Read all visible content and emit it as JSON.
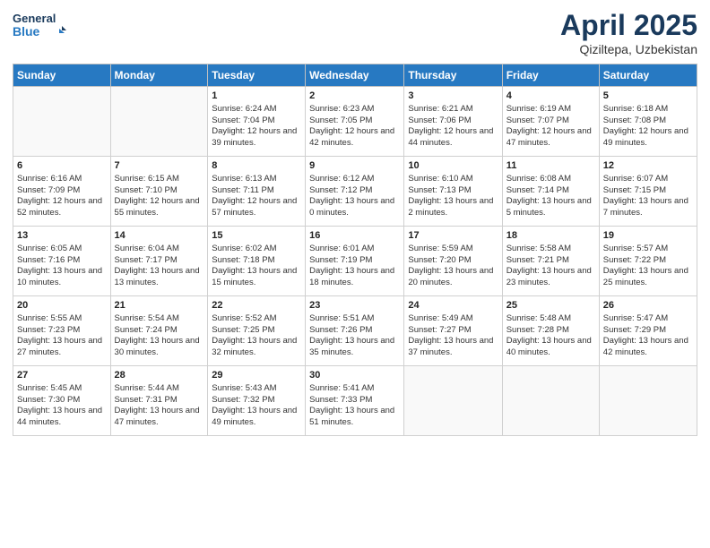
{
  "header": {
    "logo_line1": "General",
    "logo_line2": "Blue",
    "title": "April 2025",
    "subtitle": "Qiziltepa, Uzbekistan"
  },
  "days_of_week": [
    "Sunday",
    "Monday",
    "Tuesday",
    "Wednesday",
    "Thursday",
    "Friday",
    "Saturday"
  ],
  "weeks": [
    [
      {
        "day": "",
        "empty": true
      },
      {
        "day": "",
        "empty": true
      },
      {
        "day": "1",
        "sunrise": "6:24 AM",
        "sunset": "7:04 PM",
        "daylight": "12 hours and 39 minutes."
      },
      {
        "day": "2",
        "sunrise": "6:23 AM",
        "sunset": "7:05 PM",
        "daylight": "12 hours and 42 minutes."
      },
      {
        "day": "3",
        "sunrise": "6:21 AM",
        "sunset": "7:06 PM",
        "daylight": "12 hours and 44 minutes."
      },
      {
        "day": "4",
        "sunrise": "6:19 AM",
        "sunset": "7:07 PM",
        "daylight": "12 hours and 47 minutes."
      },
      {
        "day": "5",
        "sunrise": "6:18 AM",
        "sunset": "7:08 PM",
        "daylight": "12 hours and 49 minutes."
      }
    ],
    [
      {
        "day": "6",
        "sunrise": "6:16 AM",
        "sunset": "7:09 PM",
        "daylight": "12 hours and 52 minutes."
      },
      {
        "day": "7",
        "sunrise": "6:15 AM",
        "sunset": "7:10 PM",
        "daylight": "12 hours and 55 minutes."
      },
      {
        "day": "8",
        "sunrise": "6:13 AM",
        "sunset": "7:11 PM",
        "daylight": "12 hours and 57 minutes."
      },
      {
        "day": "9",
        "sunrise": "6:12 AM",
        "sunset": "7:12 PM",
        "daylight": "13 hours and 0 minutes."
      },
      {
        "day": "10",
        "sunrise": "6:10 AM",
        "sunset": "7:13 PM",
        "daylight": "13 hours and 2 minutes."
      },
      {
        "day": "11",
        "sunrise": "6:08 AM",
        "sunset": "7:14 PM",
        "daylight": "13 hours and 5 minutes."
      },
      {
        "day": "12",
        "sunrise": "6:07 AM",
        "sunset": "7:15 PM",
        "daylight": "13 hours and 7 minutes."
      }
    ],
    [
      {
        "day": "13",
        "sunrise": "6:05 AM",
        "sunset": "7:16 PM",
        "daylight": "13 hours and 10 minutes."
      },
      {
        "day": "14",
        "sunrise": "6:04 AM",
        "sunset": "7:17 PM",
        "daylight": "13 hours and 13 minutes."
      },
      {
        "day": "15",
        "sunrise": "6:02 AM",
        "sunset": "7:18 PM",
        "daylight": "13 hours and 15 minutes."
      },
      {
        "day": "16",
        "sunrise": "6:01 AM",
        "sunset": "7:19 PM",
        "daylight": "13 hours and 18 minutes."
      },
      {
        "day": "17",
        "sunrise": "5:59 AM",
        "sunset": "7:20 PM",
        "daylight": "13 hours and 20 minutes."
      },
      {
        "day": "18",
        "sunrise": "5:58 AM",
        "sunset": "7:21 PM",
        "daylight": "13 hours and 23 minutes."
      },
      {
        "day": "19",
        "sunrise": "5:57 AM",
        "sunset": "7:22 PM",
        "daylight": "13 hours and 25 minutes."
      }
    ],
    [
      {
        "day": "20",
        "sunrise": "5:55 AM",
        "sunset": "7:23 PM",
        "daylight": "13 hours and 27 minutes."
      },
      {
        "day": "21",
        "sunrise": "5:54 AM",
        "sunset": "7:24 PM",
        "daylight": "13 hours and 30 minutes."
      },
      {
        "day": "22",
        "sunrise": "5:52 AM",
        "sunset": "7:25 PM",
        "daylight": "13 hours and 32 minutes."
      },
      {
        "day": "23",
        "sunrise": "5:51 AM",
        "sunset": "7:26 PM",
        "daylight": "13 hours and 35 minutes."
      },
      {
        "day": "24",
        "sunrise": "5:49 AM",
        "sunset": "7:27 PM",
        "daylight": "13 hours and 37 minutes."
      },
      {
        "day": "25",
        "sunrise": "5:48 AM",
        "sunset": "7:28 PM",
        "daylight": "13 hours and 40 minutes."
      },
      {
        "day": "26",
        "sunrise": "5:47 AM",
        "sunset": "7:29 PM",
        "daylight": "13 hours and 42 minutes."
      }
    ],
    [
      {
        "day": "27",
        "sunrise": "5:45 AM",
        "sunset": "7:30 PM",
        "daylight": "13 hours and 44 minutes."
      },
      {
        "day": "28",
        "sunrise": "5:44 AM",
        "sunset": "7:31 PM",
        "daylight": "13 hours and 47 minutes."
      },
      {
        "day": "29",
        "sunrise": "5:43 AM",
        "sunset": "7:32 PM",
        "daylight": "13 hours and 49 minutes."
      },
      {
        "day": "30",
        "sunrise": "5:41 AM",
        "sunset": "7:33 PM",
        "daylight": "13 hours and 51 minutes."
      },
      {
        "day": "",
        "empty": true
      },
      {
        "day": "",
        "empty": true
      },
      {
        "day": "",
        "empty": true
      }
    ]
  ],
  "labels": {
    "sunrise": "Sunrise:",
    "sunset": "Sunset:",
    "daylight": "Daylight:"
  }
}
